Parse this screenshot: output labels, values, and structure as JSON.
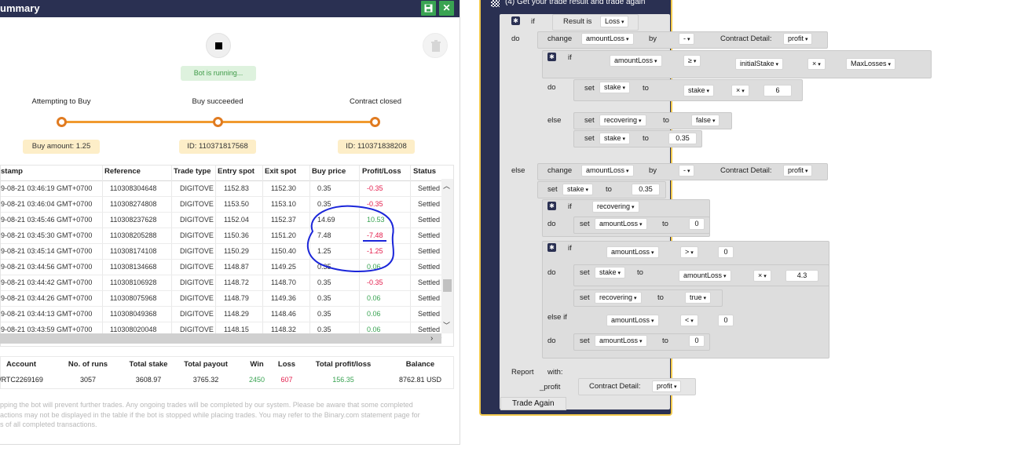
{
  "summary": {
    "title": "ummary",
    "save_icon": "save-icon",
    "close_icon": "close-icon",
    "status": "Bot is running...",
    "stages": [
      {
        "label": "Attempting to Buy",
        "detail": "Buy amount: 1.25"
      },
      {
        "label": "Buy succeeded",
        "detail": "ID: 110371817568"
      },
      {
        "label": "Contract closed",
        "detail": "ID: 110371838208"
      }
    ],
    "columns": [
      "stamp",
      "Reference",
      "Trade type",
      "Entry spot",
      "Exit spot",
      "Buy price",
      "Profit/Loss",
      "Status"
    ],
    "rows": [
      [
        "9-08-21 03:46:19 GMT+0700",
        "110308304648",
        "DIGITOVE",
        "1152.83",
        "1152.30",
        "0.35",
        "-0.35",
        "Settled"
      ],
      [
        "9-08-21 03:46:04 GMT+0700",
        "110308274808",
        "DIGITOVE",
        "1153.50",
        "1153.10",
        "0.35",
        "-0.35",
        "Settled"
      ],
      [
        "9-08-21 03:45:46 GMT+0700",
        "110308237628",
        "DIGITOVE",
        "1152.04",
        "1152.37",
        "14.69",
        "10.53",
        "Settled"
      ],
      [
        "9-08-21 03:45:30 GMT+0700",
        "110308205288",
        "DIGITOVE",
        "1150.36",
        "1151.20",
        "7.48",
        "-7.48",
        "Settled"
      ],
      [
        "9-08-21 03:45:14 GMT+0700",
        "110308174108",
        "DIGITOVE",
        "1150.29",
        "1150.40",
        "1.25",
        "-1.25",
        "Settled"
      ],
      [
        "9-08-21 03:44:56 GMT+0700",
        "110308134668",
        "DIGITOVE",
        "1148.87",
        "1149.25",
        "0.35",
        "0.06",
        "Settled"
      ],
      [
        "9-08-21 03:44:42 GMT+0700",
        "110308106928",
        "DIGITOVE",
        "1148.72",
        "1148.70",
        "0.35",
        "-0.35",
        "Settled"
      ],
      [
        "9-08-21 03:44:26 GMT+0700",
        "110308075968",
        "DIGITOVE",
        "1148.79",
        "1149.36",
        "0.35",
        "0.06",
        "Settled"
      ],
      [
        "9-08-21 03:44:13 GMT+0700",
        "110308049368",
        "DIGITOVE",
        "1148.29",
        "1148.46",
        "0.35",
        "0.06",
        "Settled"
      ],
      [
        "9-08-21 03:43:59 GMT+0700",
        "110308020048",
        "DIGITOVE",
        "1148.15",
        "1148.32",
        "0.35",
        "0.06",
        "Settled"
      ]
    ],
    "scroll_right_icon": "chevron-right-icon",
    "totals_headers": [
      "Account",
      "No. of runs",
      "Total stake",
      "Total payout",
      "Win",
      "Loss",
      "Total profit/loss",
      "Balance"
    ],
    "totals_values": [
      "/RTC2269169",
      "3057",
      "3608.97",
      "3765.32",
      "2450",
      "607",
      "156.35",
      "8762.81 USD"
    ],
    "disclaimer": [
      "pping the bot will prevent further trades. Any ongoing trades will be completed by our system. Please be aware that some completed",
      "actions may not be displayed in the table if the bot is stopped while placing trades. You may refer to the Binary.com statement page for",
      "s of all completed transactions."
    ],
    "colors": {
      "header": "#2a3052",
      "green": "#39a352",
      "loss": "#e31c4b",
      "profit": "#39a352",
      "track": "#e07b21"
    }
  },
  "blockly": {
    "title": "(4) Get your trade result and trade again",
    "flag_icon": "checkered-flag-icon",
    "if": "if",
    "do": "do",
    "else": "else",
    "else_if": "else if",
    "result_is": "Result is",
    "loss": "Loss",
    "change": "change",
    "by": "by",
    "set": "set",
    "to": "to",
    "amountLoss": "amountLoss",
    "minus": "-",
    "contract_detail": "Contract Detail:",
    "profit": "profit",
    "gte": "≥",
    "initialStake": "initialStake",
    "times": "×",
    "maxLosses": "MaxLosses",
    "stake": "stake",
    "six": "6",
    "recovering": "recovering",
    "false": "false",
    "v035": "0.35",
    "zero": "0",
    "gt": ">",
    "lt": "<",
    "v43": "4.3",
    "true": "true",
    "report": "Report",
    "with": "with:",
    "_profit": "_profit",
    "trade_again": "Trade Again"
  }
}
